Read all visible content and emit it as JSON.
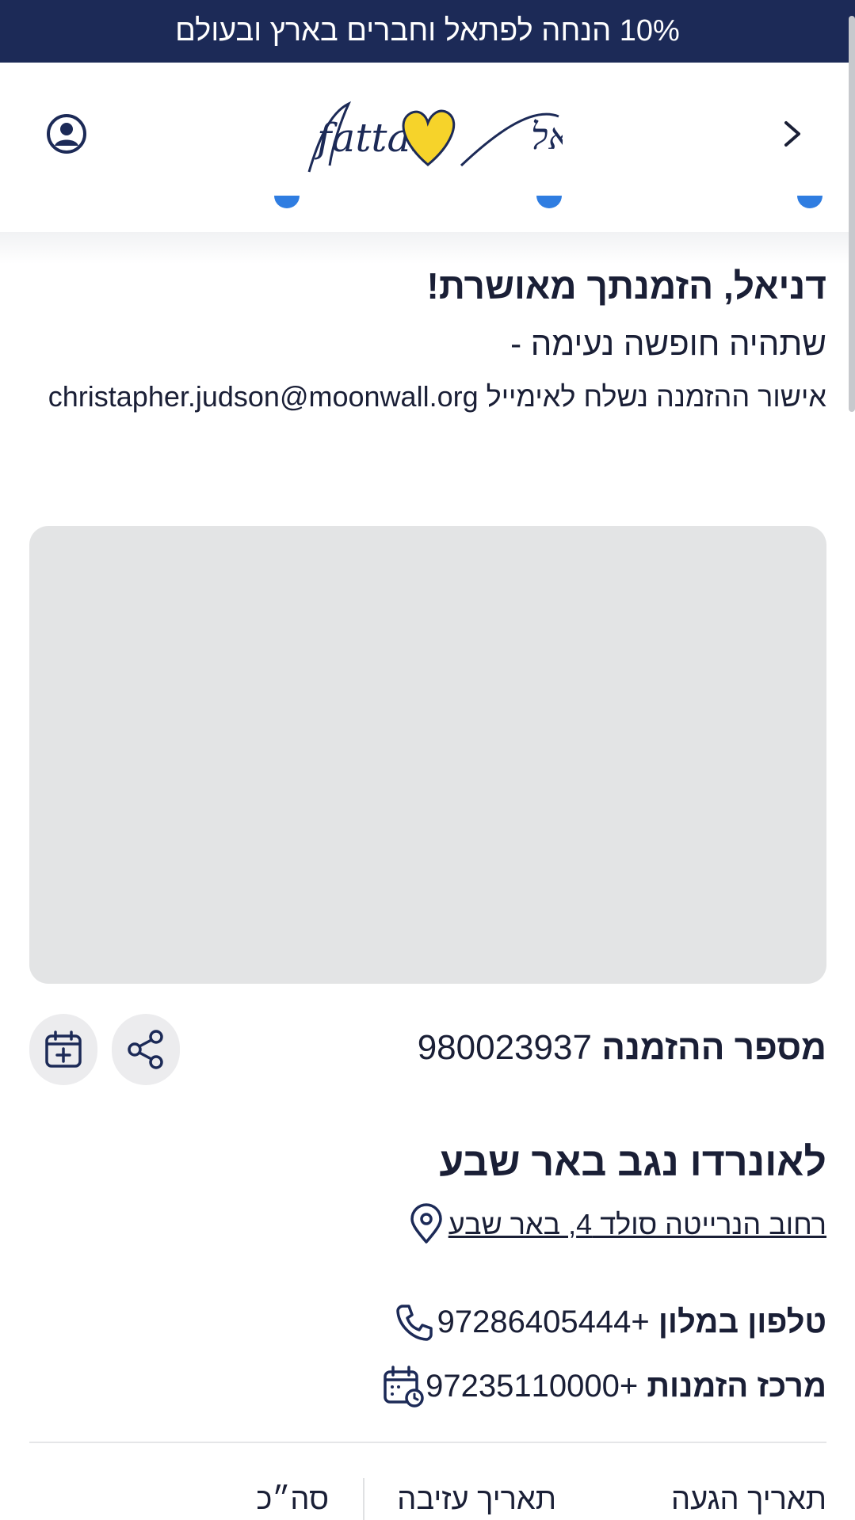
{
  "promo": {
    "text": "10% הנחה לפתאל וחברים בארץ ובעולם"
  },
  "header": {
    "logo_text_latin": "fattal",
    "logo_text_hebrew": "פתאל",
    "colors": {
      "navy": "#1c2a57",
      "heart": "#f6d32a",
      "accent": "#2f7de1"
    }
  },
  "confirmation": {
    "greeting": "דניאל, הזמנתך מאושרת!",
    "subtitle": "שתהיה חופשה נעימה -",
    "email_prefix": "אישור ההזמנה נשלח לאימייל",
    "email": "christapher.judson@moonwall.org"
  },
  "booking": {
    "order_label": "מספר ההזמנה",
    "order_number": "980023937"
  },
  "hotel": {
    "name": "לאונרדו נגב באר שבע",
    "address": "רחוב הנרייטה סולד 4, באר שבע",
    "phone_label": "טלפון במלון",
    "phone": "+97286405444",
    "booking_center_label": "מרכז הזמנות",
    "booking_center_phone": "+97235110000"
  },
  "summary": {
    "arrival_label": "תאריך הגעה",
    "departure_label": "תאריך עזיבה",
    "total_label": "סה״כ"
  }
}
